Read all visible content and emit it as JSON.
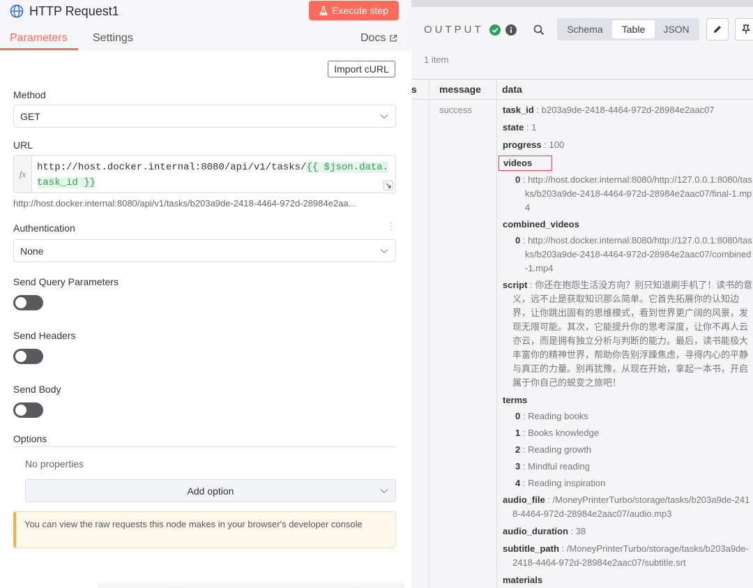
{
  "node": {
    "title": "HTTP Request1",
    "execute_label": "Execute step",
    "tabs": [
      "Parameters",
      "Settings"
    ],
    "docs_label": "Docs"
  },
  "params": {
    "import_curl_label": "Import cURL",
    "method_label": "Method",
    "method_value": "GET",
    "url_label": "URL",
    "url_static": "http://host.docker.internal:8080/api/v1/tasks/",
    "url_expression": "{{ $json.data.task_id }}",
    "url_preview": "http://host.docker.internal:8080/api/v1/tasks/b203a9de-2418-4464-972d-28984e2aa...",
    "auth_label": "Authentication",
    "auth_value": "None",
    "send_query_label": "Send Query Parameters",
    "send_headers_label": "Send Headers",
    "send_body_label": "Send Body",
    "options_label": "Options",
    "no_properties": "No properties",
    "add_option_label": "Add option",
    "notice": "You can view the raw requests this node makes in your browser's developer console"
  },
  "toggles": {
    "send_query": false,
    "send_headers": false,
    "send_body": false
  },
  "output": {
    "label": "OUTPUT",
    "views": [
      "Schema",
      "Table",
      "JSON"
    ],
    "active_view": "Table",
    "item_count": "1 item",
    "columns": [
      "s",
      "message",
      "data"
    ],
    "message_value": "success",
    "data": {
      "task_id_key": "task_id",
      "task_id": "b203a9de-2418-4464-972d-28984e2aac07",
      "state_key": "state",
      "state": "1",
      "progress_key": "progress",
      "progress": "100",
      "videos_key": "videos",
      "videos": [
        {
          "index": "0",
          "value": "http://host.docker.internal:8080/http://127.0.0.1:8080/tasks/b203a9de-2418-4464-972d-28984e2aac07/final-1.mp4"
        }
      ],
      "combined_videos_key": "combined_videos",
      "combined_videos": [
        {
          "index": "0",
          "value": "http://host.docker.internal:8080/http://127.0.0.1:8080/tasks/b203a9de-2418-4464-972d-28984e2aac07/combined-1.mp4"
        }
      ],
      "script_key": "script",
      "script": "你还在抱怨生活没方向？别只知道刷手机了！读书的意义，远不止是获取知识那么简单。它首先拓展你的认知边界，让你跳出固有的思维模式，看到世界更广阔的风景，发现无限可能。其次，它能提升你的思考深度，让你不再人云亦云，而是拥有独立分析与判断的能力。最后，读书能极大丰富你的精神世界，帮助你告别浮躁焦虑，寻得内心的平静与真正的力量。别再犹豫，从现在开始，拿起一本书，开启属于你自己的蜕变之旅吧！",
      "terms_key": "terms",
      "terms": [
        {
          "index": "0",
          "value": "Reading books"
        },
        {
          "index": "1",
          "value": "Books knowledge"
        },
        {
          "index": "2",
          "value": "Reading growth"
        },
        {
          "index": "3",
          "value": "Mindful reading"
        },
        {
          "index": "4",
          "value": "Reading inspiration"
        }
      ],
      "audio_file_key": "audio_file",
      "audio_file": "/MoneyPrinterTurbo/storage/tasks/b203a9de-2418-4464-972d-28984e2aac07/audio.mp3",
      "audio_duration_key": "audio_duration",
      "audio_duration": "38",
      "subtitle_path_key": "subtitle_path",
      "subtitle_path": "/MoneyPrinterTurbo/storage/tasks/b203a9de-2418-4464-972d-28984e2aac07/subtitle.srt",
      "materials_key": "materials"
    }
  },
  "colors": {
    "accent": "#ff6d5a",
    "success": "#29a35a",
    "highlight_box": "#e04040"
  }
}
